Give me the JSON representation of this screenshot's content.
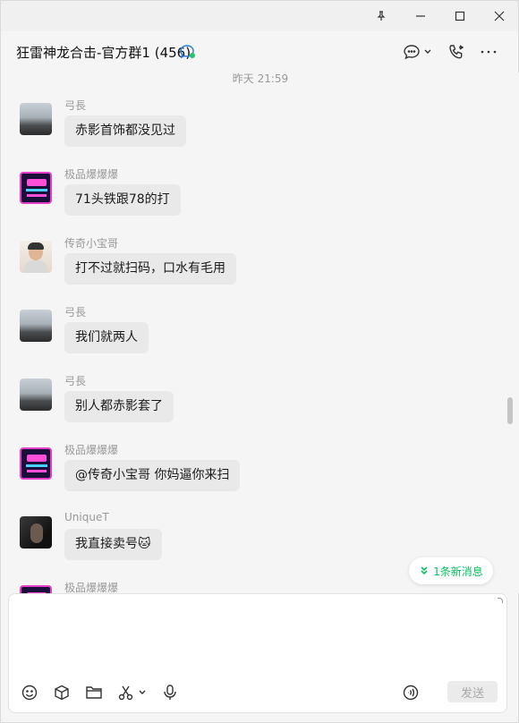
{
  "window": {
    "controls": [
      "pin-icon",
      "minimize-icon",
      "maximize-icon",
      "close-icon"
    ]
  },
  "header": {
    "title": "狂雷神龙合击-官方群1 (456)",
    "icons": [
      "group-chat-icon",
      "comment-dropdown-icon",
      "phone-video-icon",
      "more-icon"
    ]
  },
  "timestamp": "昨天 21:59",
  "messages": [
    {
      "sender": "弓長",
      "text": "赤影首饰都没见过",
      "avatar": "sunset"
    },
    {
      "sender": "极品爆爆爆",
      "text": "71头铁跟78的打",
      "avatar": "neon"
    },
    {
      "sender": "传奇小宝哥",
      "text": "打不过就扫码，口水有毛用",
      "avatar": "face"
    },
    {
      "sender": "弓長",
      "text": "我们就两人",
      "avatar": "sunset"
    },
    {
      "sender": "弓長",
      "text": "别人都赤影套了",
      "avatar": "sunset"
    },
    {
      "sender": "极品爆爆爆",
      "text": "@传奇小宝哥 你妈逼你来扫",
      "avatar": "neon"
    },
    {
      "sender": "UniqueT",
      "text": "我直接卖号🐱",
      "avatar": "dark"
    },
    {
      "sender": "极品爆爆爆",
      "text": "",
      "avatar": "neon"
    }
  ],
  "new_messages_label": "1条新消息",
  "input": {
    "value": "",
    "placeholder": ""
  },
  "toolbar": {
    "icons": [
      "emoji-icon",
      "box-icon",
      "folder-icon",
      "scissors-icon",
      "microphone-icon",
      "voice-icon"
    ],
    "send_label": "发送"
  },
  "colors": {
    "accent": "#07c160",
    "bubble": "#e9e9e9",
    "background": "#f5f5f5"
  }
}
